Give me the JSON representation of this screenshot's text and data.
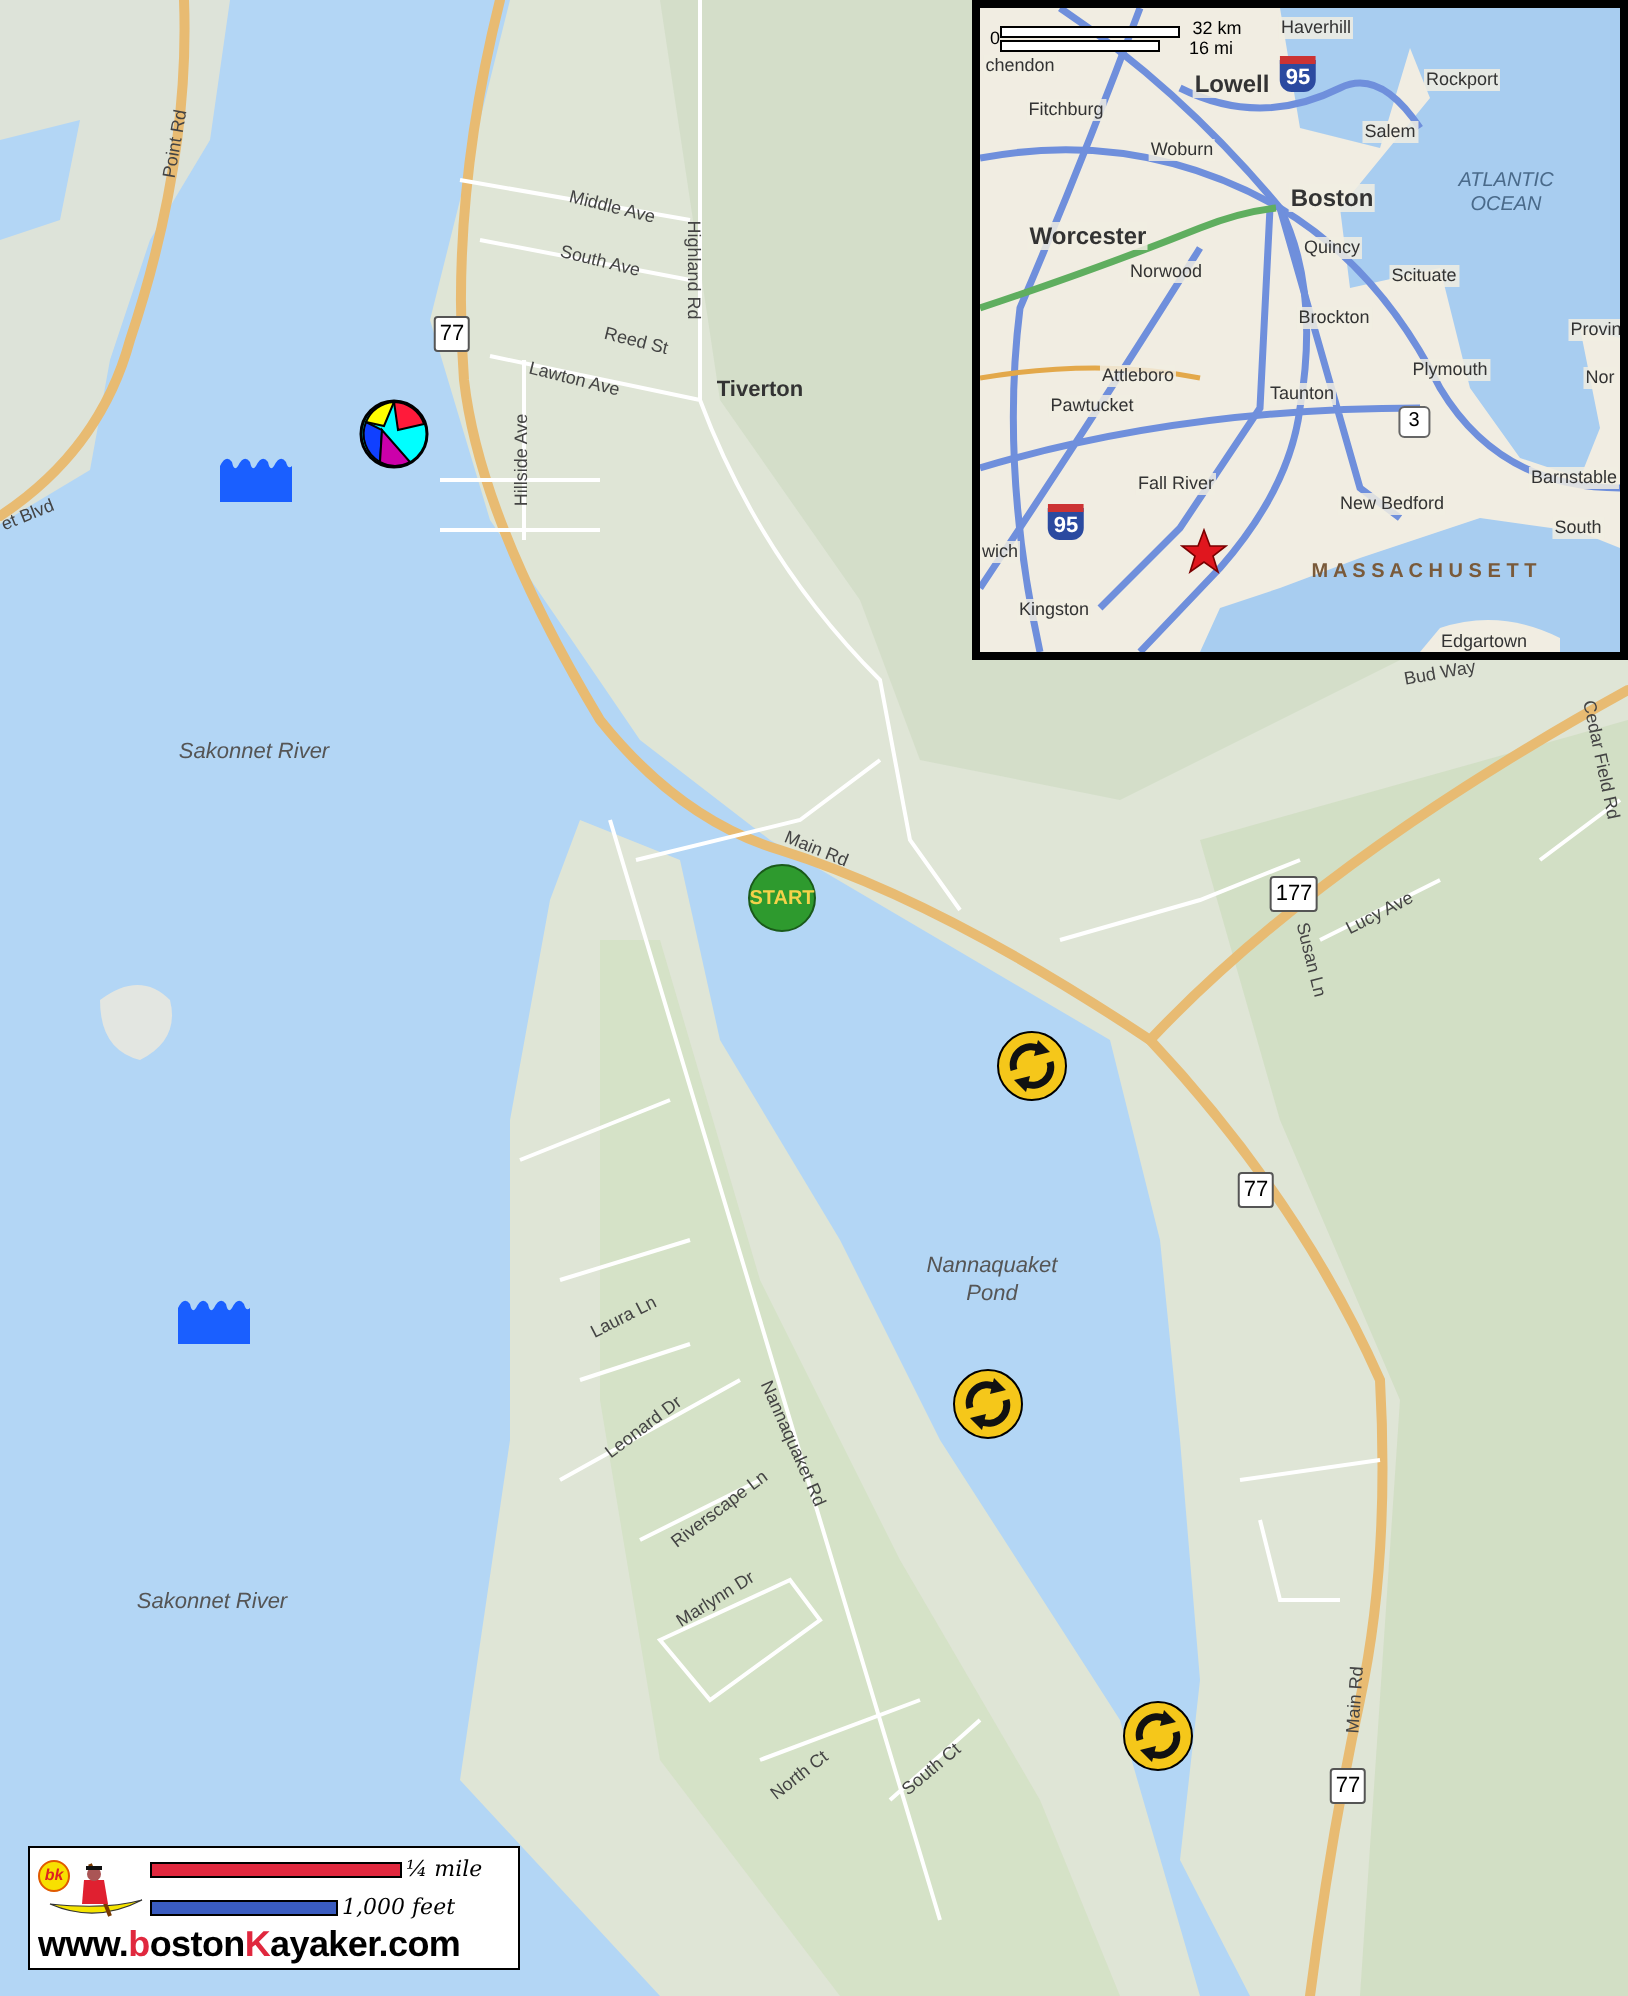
{
  "map": {
    "labels": [
      {
        "text": "Point Rd",
        "kind": "street"
      },
      {
        "text": "Middle Ave",
        "kind": "street"
      },
      {
        "text": "South Ave",
        "kind": "street"
      },
      {
        "text": "Highland Rd",
        "kind": "street"
      },
      {
        "text": "Reed St",
        "kind": "street"
      },
      {
        "text": "Lawton Ave",
        "kind": "street"
      },
      {
        "text": "Tiverton",
        "kind": "town"
      },
      {
        "text": "Hillside Ave",
        "kind": "street"
      },
      {
        "text": "et Blvd",
        "kind": "street"
      },
      {
        "text": "Bud Way",
        "kind": "street"
      },
      {
        "text": "Cedar Field Rd",
        "kind": "street"
      },
      {
        "text": "Sakonnet River",
        "kind": "water"
      },
      {
        "text": "Main Rd",
        "kind": "street"
      },
      {
        "text": "Lucy Ave",
        "kind": "street"
      },
      {
        "text": "Susan Ln",
        "kind": "street"
      },
      {
        "text": "Nannaquaket Pond",
        "kind": "water"
      },
      {
        "text": "Laura Ln",
        "kind": "street"
      },
      {
        "text": "Leonard Dr",
        "kind": "street"
      },
      {
        "text": "Nannaquaket Rd",
        "kind": "street"
      },
      {
        "text": "Riverscape Ln",
        "kind": "street"
      },
      {
        "text": "Marlynn Dr",
        "kind": "street"
      },
      {
        "text": "Sakonnet River",
        "kind": "water"
      },
      {
        "text": "North Ct",
        "kind": "street"
      },
      {
        "text": "South Ct",
        "kind": "street"
      },
      {
        "text": "Main Rd",
        "kind": "street"
      }
    ],
    "shields": [
      "77",
      "177",
      "77",
      "77"
    ],
    "markers": [
      {
        "kind": "beach_ball"
      },
      {
        "kind": "waves"
      },
      {
        "kind": "start",
        "text": "START"
      },
      {
        "kind": "loop"
      },
      {
        "kind": "waves"
      },
      {
        "kind": "loop"
      },
      {
        "kind": "loop"
      }
    ]
  },
  "inset": {
    "scale": [
      "0",
      "32 km",
      "16 mi"
    ],
    "labels": [
      {
        "text": "chendon",
        "kind": "city"
      },
      {
        "text": "Haverhill",
        "kind": "city"
      },
      {
        "text": "Lowell",
        "kind": "major_city"
      },
      {
        "text": "Rockport",
        "kind": "city"
      },
      {
        "text": "Fitchburg",
        "kind": "city"
      },
      {
        "text": "Salem",
        "kind": "city"
      },
      {
        "text": "Woburn",
        "kind": "city"
      },
      {
        "text": "Boston",
        "kind": "major_city"
      },
      {
        "text": "ATLANTIC OCEAN",
        "kind": "water"
      },
      {
        "text": "Worcester",
        "kind": "major_city"
      },
      {
        "text": "Quincy",
        "kind": "city"
      },
      {
        "text": "Norwood",
        "kind": "city"
      },
      {
        "text": "Scituate",
        "kind": "city"
      },
      {
        "text": "Brockton",
        "kind": "city"
      },
      {
        "text": "Provin",
        "kind": "city"
      },
      {
        "text": "Attleboro",
        "kind": "city"
      },
      {
        "text": "Plymouth",
        "kind": "city"
      },
      {
        "text": "Nor",
        "kind": "city"
      },
      {
        "text": "Pawtucket",
        "kind": "city"
      },
      {
        "text": "Taunton",
        "kind": "city"
      },
      {
        "text": "Fall River",
        "kind": "city"
      },
      {
        "text": "Barnstable",
        "kind": "city"
      },
      {
        "text": "New Bedford",
        "kind": "city"
      },
      {
        "text": "South",
        "kind": "city"
      },
      {
        "text": "wich",
        "kind": "city"
      },
      {
        "text": "M A S S A C H U S E T T",
        "kind": "region"
      },
      {
        "text": "Kingston",
        "kind": "city"
      },
      {
        "text": "Edgartown",
        "kind": "city"
      }
    ],
    "shields": [
      {
        "text": "95",
        "kind": "interstate"
      },
      {
        "text": "3",
        "kind": "state"
      },
      {
        "text": "95",
        "kind": "interstate"
      }
    ]
  },
  "legend": {
    "logo_text": "bk",
    "scales": [
      {
        "text": "¼ mile",
        "kind": "mile"
      },
      {
        "text": "1,000 feet",
        "kind": "feet"
      }
    ],
    "url": [
      {
        "text": "www.",
        "accent": false
      },
      {
        "text": "b",
        "accent": true
      },
      {
        "text": "oston",
        "accent": false
      },
      {
        "text": "K",
        "accent": true
      },
      {
        "text": "ayaker.com",
        "accent": false
      }
    ]
  }
}
